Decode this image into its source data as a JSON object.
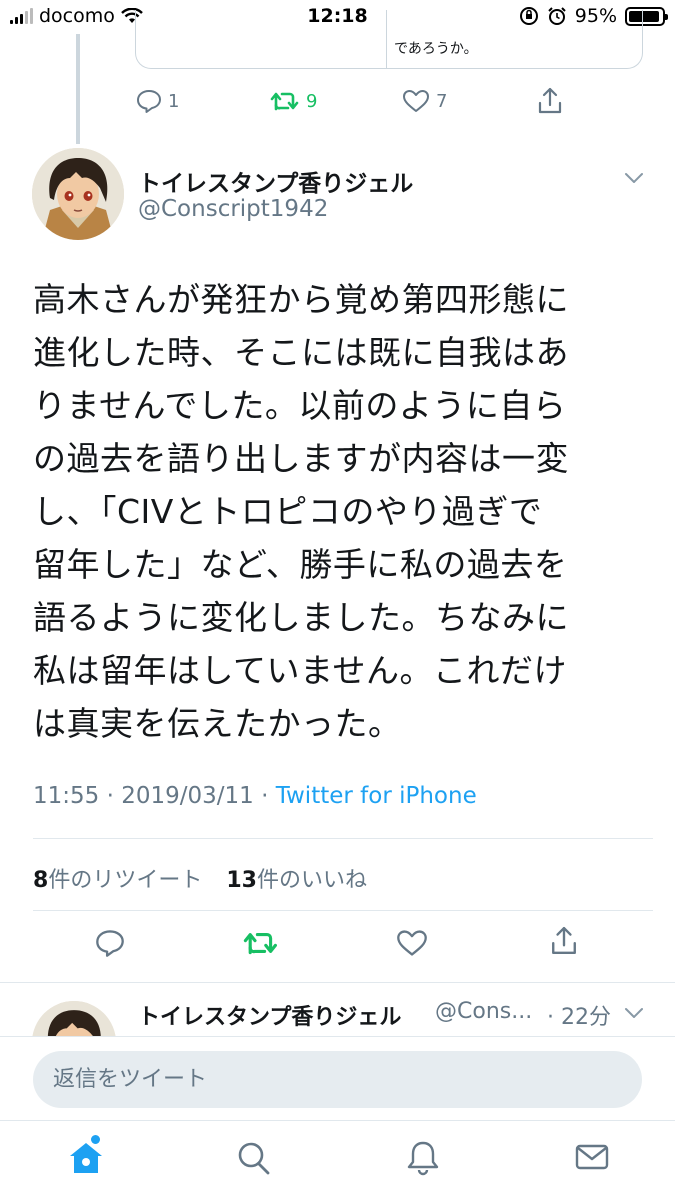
{
  "status_bar": {
    "carrier": "docomo",
    "time": "12:18",
    "battery": "95%",
    "battery_fraction": 0.95
  },
  "previous_tweet": {
    "quote_text": "であろうか。",
    "reply_count": "1",
    "retweet_count": "9",
    "like_count": "7"
  },
  "tweet": {
    "author_name": "トイレスタンプ香りジェル",
    "author_handle": "@Conscript1942",
    "text": "高木さんが発狂から覚め第四形態に\n進化した時、そこには既に自我はあ\nりませんでした。以前のように自ら\nの過去を語り出しますが内容は一変\nし、「CIVとトロピコのやり過ぎで\n留年した」など、勝手に私の過去を\n語るように変化しました。ちなみに\n私は留年はしていません。これだけ\nは真実を伝えたかった。",
    "time": "11:55",
    "date": "2019/03/11",
    "separator": " · ",
    "source": "Twitter for iPhone",
    "retweet_count": "8",
    "retweet_label": "件のリツイート",
    "like_count": "13",
    "like_label": "件のいいね"
  },
  "reply_tweet": {
    "author_name": "トイレスタンプ香りジェル",
    "author_handle": "@Cons...",
    "time": "· 22分"
  },
  "reply_box": {
    "placeholder": "返信をツイート"
  },
  "colors": {
    "accent": "#1da1f2",
    "retweet": "#17bf63",
    "muted": "#657786",
    "text": "#14171a"
  },
  "tab_bar": {
    "items": [
      "home-icon",
      "search-icon",
      "notifications-icon",
      "messages-icon"
    ],
    "active": "home-icon"
  }
}
